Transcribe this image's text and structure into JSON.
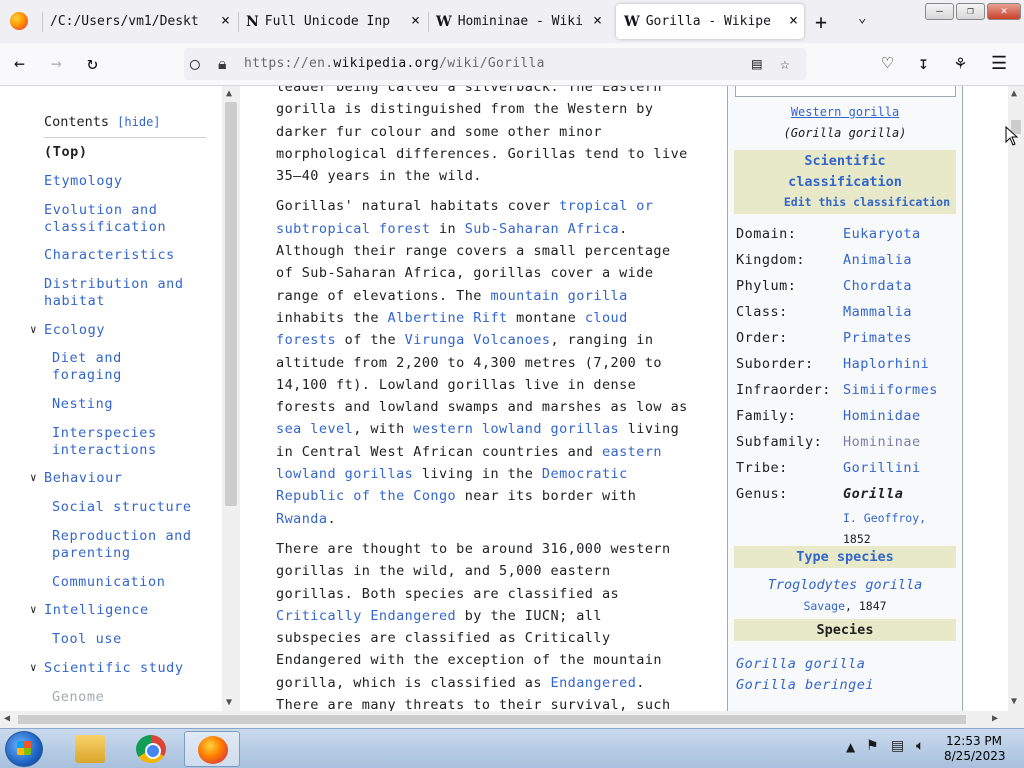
{
  "browser": {
    "tabs": [
      {
        "title": "/C:/Users/vm1/Deskt",
        "close": "×"
      },
      {
        "title": "Full Unicode Inp",
        "close": "×"
      },
      {
        "title": "Homininae - Wiki",
        "close": "×"
      },
      {
        "title": "Gorilla - Wikipe",
        "close": "×"
      }
    ],
    "new_tab": "+",
    "tab_list": "⌄",
    "window_controls": {
      "minimize": "—",
      "maximize": "❐",
      "close": "✕"
    },
    "url": {
      "prefix": "https://en.",
      "domain": "wikipedia.org",
      "path": "/wiki/Gorilla"
    },
    "icons": [
      "back-arrow-icon",
      "forward-arrow-icon",
      "reload-icon",
      "shield-icon",
      "lock-icon",
      "reader-view-icon",
      "bookmark-star-icon",
      "pocket-icon",
      "download-icon",
      "extensions-icon",
      "menu-icon"
    ]
  },
  "toc": {
    "title": "Contents",
    "hide": "[hide]",
    "items": [
      {
        "label": "(Top)"
      },
      {
        "label": "Etymology"
      },
      {
        "label": "Evolution and classification"
      },
      {
        "label": "Characteristics"
      },
      {
        "label": "Distribution and habitat"
      },
      {
        "label": "Ecology"
      },
      {
        "label": "Diet and foraging"
      },
      {
        "label": "Nesting"
      },
      {
        "label": "Interspecies interactions"
      },
      {
        "label": "Behaviour"
      },
      {
        "label": "Social structure"
      },
      {
        "label": "Reproduction and parenting"
      },
      {
        "label": "Communication"
      },
      {
        "label": "Intelligence"
      },
      {
        "label": "Tool use"
      },
      {
        "label": "Scientific study"
      },
      {
        "label": "Genome"
      }
    ]
  },
  "article": {
    "p1": {
      "t1": "leader being called a silverback. The Eastern gorilla is distinguished from the Western by darker fur colour and some other minor morphological differences. Gorillas tend to live 35–40 years in the wild."
    },
    "p2": {
      "t1": "Gorillas' natural habitats cover ",
      "l1": "tropical or subtropical forest",
      "t2": " in ",
      "l2": "Sub-Saharan Africa",
      "t3": ". Although their range covers a small percentage of Sub-Saharan Africa, gorillas cover a wide range of elevations. The ",
      "l3": "mountain gorilla",
      "t4": " inhabits the ",
      "l4": "Albertine Rift",
      "t5": " montane ",
      "l5": "cloud forests",
      "t6": " of the ",
      "l6": "Virunga Volcanoes",
      "t7": ", ranging in altitude from 2,200 to 4,300 metres (7,200 to 14,100 ft). Lowland gorillas live in dense forests and lowland swamps and marshes as low as ",
      "l7": "sea level",
      "t8": ", with ",
      "l8": "western lowland gorillas",
      "t9": " living in Central West African countries and ",
      "l9": "eastern lowland gorillas",
      "t10": " living in the ",
      "l10": "Democratic Republic of the Congo",
      "t11": " near its border with ",
      "l11": "Rwanda",
      "t12": "."
    },
    "p3": {
      "t1": "There are thought to be around 316,000 western gorillas in the wild, and 5,000 eastern gorillas. Both species are classified as ",
      "l1": "Critically Endangered",
      "t2": " by the IUCN; all subspecies are classified as Critically Endangered with the exception of the mountain gorilla, which is classified as ",
      "l2": "Endangered",
      "t3": ". There are many threats to their survival, such"
    }
  },
  "infobox": {
    "image_caption_link": "Western gorilla",
    "image_caption_sci": "(Gorilla gorilla)",
    "sci_class": "Scientific classification",
    "edit": "Edit this classification",
    "rows": [
      {
        "key": "Domain:",
        "val": "Eukaryota"
      },
      {
        "key": "Kingdom:",
        "val": "Animalia"
      },
      {
        "key": "Phylum:",
        "val": "Chordata"
      },
      {
        "key": "Class:",
        "val": "Mammalia"
      },
      {
        "key": "Order:",
        "val": "Primates"
      },
      {
        "key": "Suborder:",
        "val": "Haplorhini"
      },
      {
        "key": "Infraorder:",
        "val": "Simiiformes"
      },
      {
        "key": "Family:",
        "val": "Hominidae"
      },
      {
        "key": "Subfamily:",
        "val": "Homininae"
      },
      {
        "key": "Tribe:",
        "val": "Gorillini"
      },
      {
        "key": "Genus:",
        "val": "Gorilla"
      }
    ],
    "genus_author": "I. Geoffroy,",
    "genus_year": "1852",
    "type_species_title": "Type species",
    "type_species": "Troglodytes gorilla",
    "type_species_author": "Savage",
    "type_species_year": ", 1847",
    "species_title": "Species",
    "species": [
      "Gorilla gorilla",
      "Gorilla beringei"
    ]
  },
  "taskbar": {
    "time": "12:53 PM",
    "date": "8/25/2023",
    "apps": [
      "file-explorer-icon",
      "chrome-icon",
      "firefox-icon"
    ]
  }
}
